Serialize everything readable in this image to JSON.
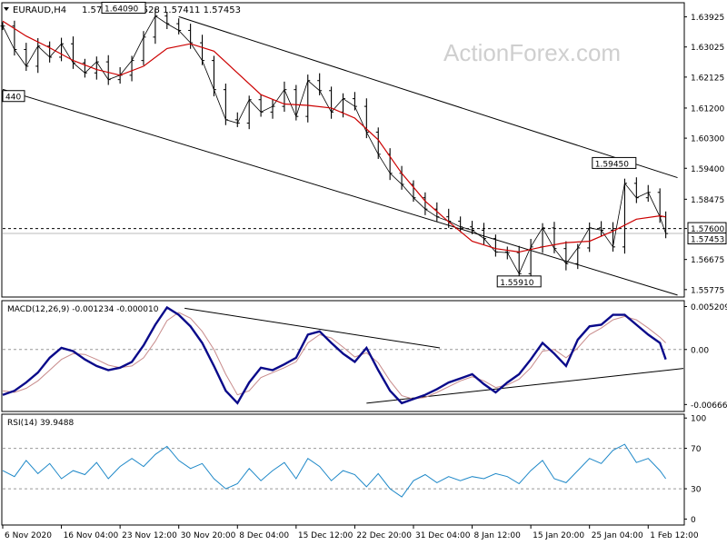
{
  "chart_data": {
    "type": "candlestick",
    "symbol_header": "EURAUD,H4",
    "ohlc_header": "1.57525 1.57528 1.57411 1.57453",
    "watermark": "ActionForex.com",
    "price_axis_ticks": [
      "1.63925",
      "1.63025",
      "1.62125",
      "1.61200",
      "1.60300",
      "1.59400",
      "1.58475",
      "1.57600",
      "1.56675",
      "1.55775"
    ],
    "price_tick_values": [
      1.63925,
      1.63025,
      1.62125,
      1.612,
      1.603,
      1.594,
      1.58475,
      1.576,
      1.56675,
      1.55775
    ],
    "ylim": [
      1.5558,
      1.6432
    ],
    "current_price": {
      "value": 1.576,
      "label": "1.57600"
    },
    "last_price": {
      "value": 1.57453,
      "label": "1.57453"
    },
    "annotations": [
      {
        "label": "1.64090",
        "x": 20.6,
        "y": 1.6409
      },
      {
        "label": "1.59450",
        "x": 104.2,
        "y": 1.5945
      },
      {
        "label": "1.55910",
        "x": 88.0,
        "y": 1.5591
      },
      {
        "label": "440",
        "x": 0.2,
        "y": 1.6145
      }
    ],
    "trendlines_price": [
      {
        "x": [
          0.0,
          115.0
        ],
        "y": [
          1.6176,
          1.5561
        ]
      },
      {
        "x": [
          30.0,
          115.0
        ],
        "y": [
          1.6393,
          1.5912
        ]
      }
    ],
    "x_ticks": [
      "6 Nov 2020",
      "16 Nov 04:00",
      "23 Nov 12:00",
      "30 Nov 20:00",
      "8 Dec 04:00",
      "15 Dec 12:00",
      "22 Dec 20:00",
      "31 Dec 04:00",
      "8 Jan 12:00",
      "15 Jan 20:00",
      "25 Jan 04:00",
      "1 Feb 12:00"
    ],
    "x_tick_pos": [
      0,
      10,
      20,
      30,
      40,
      50,
      60,
      70,
      80,
      90,
      100,
      110
    ],
    "xlim": [
      0,
      116
    ],
    "price_series": {
      "x": [
        0,
        2,
        4,
        6,
        8,
        10,
        12,
        14,
        16,
        18,
        20,
        22,
        24,
        26,
        28,
        30,
        32,
        34,
        36,
        38,
        40,
        42,
        44,
        46,
        48,
        50,
        52,
        54,
        56,
        58,
        60,
        62,
        64,
        66,
        68,
        70,
        72,
        74,
        76,
        78,
        80,
        82,
        84,
        86,
        88,
        90,
        92,
        94,
        96,
        98,
        100,
        102,
        104,
        106,
        108,
        110,
        112,
        113
      ],
      "close": [
        1.6365,
        1.6295,
        1.6245,
        1.6305,
        1.6272,
        1.6312,
        1.6255,
        1.6225,
        1.6258,
        1.6205,
        1.6218,
        1.6262,
        1.6332,
        1.6395,
        1.6372,
        1.6352,
        1.6315,
        1.6262,
        1.6175,
        1.6085,
        1.6075,
        1.6145,
        1.6108,
        1.6125,
        1.6175,
        1.6095,
        1.6202,
        1.6172,
        1.6108,
        1.6148,
        1.6125,
        1.6048,
        1.5982,
        1.5925,
        1.5892,
        1.5852,
        1.5818,
        1.5795,
        1.5782,
        1.5765,
        1.5755,
        1.573,
        1.569,
        1.5688,
        1.5625,
        1.5705,
        1.5762,
        1.57,
        1.5655,
        1.5702,
        1.5762,
        1.5755,
        1.5705,
        1.5895,
        1.5852,
        1.5868,
        1.5795,
        1.5745
      ]
    },
    "ma_series": {
      "x": [
        0,
        4,
        8,
        12,
        16,
        20,
        24,
        28,
        32,
        36,
        40,
        44,
        48,
        52,
        56,
        60,
        64,
        68,
        72,
        76,
        80,
        84,
        88,
        92,
        96,
        100,
        104,
        108,
        112,
        113
      ],
      "y": [
        1.638,
        1.6335,
        1.63,
        1.6262,
        1.6235,
        1.6218,
        1.6245,
        1.6298,
        1.6312,
        1.629,
        1.6225,
        1.616,
        1.6132,
        1.6128,
        1.612,
        1.609,
        1.6025,
        1.5925,
        1.5842,
        1.578,
        1.5722,
        1.57,
        1.569,
        1.5705,
        1.5718,
        1.5722,
        1.5752,
        1.5788,
        1.5798,
        1.5795
      ]
    },
    "macd": {
      "label": "MACD(12,26,9) -0.001234 -0.000010",
      "ticks": [
        "0.005209",
        "0.00",
        "-0.006668"
      ],
      "tick_values": [
        0.005209,
        0.0,
        -0.006668
      ],
      "ylim": [
        -0.0074,
        0.0057
      ],
      "x": [
        0,
        2,
        4,
        6,
        8,
        10,
        12,
        14,
        16,
        18,
        20,
        22,
        24,
        26,
        28,
        30,
        32,
        34,
        36,
        38,
        40,
        42,
        44,
        46,
        48,
        50,
        52,
        54,
        56,
        58,
        60,
        62,
        64,
        66,
        68,
        70,
        72,
        74,
        76,
        78,
        80,
        82,
        84,
        86,
        88,
        90,
        92,
        94,
        96,
        98,
        100,
        102,
        104,
        106,
        108,
        110,
        112,
        113
      ],
      "macd": [
        -0.0055,
        -0.005,
        -0.004,
        -0.0028,
        -0.001,
        0.0002,
        -0.0002,
        -0.0012,
        -0.002,
        -0.0025,
        -0.0022,
        -0.0015,
        0.0005,
        0.003,
        0.0051,
        0.0042,
        0.0028,
        0.0008,
        -0.002,
        -0.005,
        -0.0065,
        -0.004,
        -0.0022,
        -0.0025,
        -0.0018,
        -0.001,
        0.0018,
        0.0022,
        0.0008,
        -0.0005,
        -0.0015,
        0.0002,
        -0.0025,
        -0.005,
        -0.0065,
        -0.006,
        -0.0055,
        -0.0048,
        -0.004,
        -0.0035,
        -0.003,
        -0.0042,
        -0.0052,
        -0.004,
        -0.003,
        -0.0012,
        0.0008,
        -0.0005,
        -0.002,
        0.0012,
        0.0028,
        0.003,
        0.0042,
        0.0042,
        0.003,
        0.0018,
        0.0008,
        -0.0012
      ],
      "signal": [
        -0.005,
        -0.0052,
        -0.0047,
        -0.0038,
        -0.0025,
        -0.0012,
        -0.0005,
        -0.0006,
        -0.0012,
        -0.0019,
        -0.0022,
        -0.002,
        -0.001,
        0.001,
        0.0035,
        0.0045,
        0.0038,
        0.0022,
        0.0,
        -0.003,
        -0.0055,
        -0.005,
        -0.0034,
        -0.0028,
        -0.0022,
        -0.0015,
        0.0008,
        0.0018,
        0.0014,
        0.0003,
        -0.0009,
        -0.0004,
        -0.0016,
        -0.0038,
        -0.0056,
        -0.006,
        -0.0058,
        -0.0052,
        -0.0045,
        -0.0038,
        -0.0033,
        -0.0038,
        -0.0046,
        -0.0043,
        -0.0036,
        -0.0022,
        -0.0002,
        0.0,
        -0.001,
        0.0002,
        0.0018,
        0.0026,
        0.0036,
        0.004,
        0.0036,
        0.0026,
        0.0015,
        0.0008
      ],
      "trendlines": [
        {
          "x": [
            31.0,
            74.5
          ],
          "y": [
            0.005,
            0.0002
          ]
        },
        {
          "x": [
            62.0,
            116.0
          ],
          "y": [
            -0.0065,
            -0.0023
          ]
        }
      ]
    },
    "rsi": {
      "label": "RSI(14) 39.9488",
      "ticks": [
        "100",
        "70",
        "30",
        "0"
      ],
      "tick_values": [
        100,
        70,
        30,
        0
      ],
      "levels": [
        70,
        30
      ],
      "ylim": [
        -5,
        102
      ],
      "x": [
        0,
        2,
        4,
        6,
        8,
        10,
        12,
        14,
        16,
        18,
        20,
        22,
        24,
        26,
        28,
        30,
        32,
        34,
        36,
        38,
        40,
        42,
        44,
        46,
        48,
        50,
        52,
        54,
        56,
        58,
        60,
        62,
        64,
        66,
        68,
        70,
        72,
        74,
        76,
        78,
        80,
        82,
        84,
        86,
        88,
        90,
        92,
        94,
        96,
        98,
        100,
        102,
        104,
        106,
        108,
        110,
        112,
        113
      ],
      "y": [
        48,
        42,
        58,
        45,
        55,
        40,
        48,
        44,
        56,
        40,
        52,
        60,
        52,
        64,
        72,
        58,
        50,
        55,
        40,
        30,
        35,
        50,
        38,
        48,
        56,
        40,
        60,
        52,
        38,
        48,
        44,
        32,
        45,
        30,
        22,
        38,
        44,
        36,
        42,
        38,
        42,
        40,
        45,
        42,
        35,
        48,
        58,
        40,
        36,
        48,
        60,
        55,
        68,
        74,
        56,
        60,
        48,
        40
      ]
    }
  }
}
